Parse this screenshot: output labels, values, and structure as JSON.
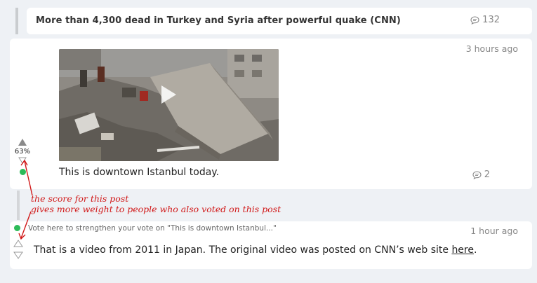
{
  "thread": {
    "title": "More than 4,300 dead in Turkey and Syria after powerful quake (CNN)",
    "comment_count": "132"
  },
  "post": {
    "time": "3 hours ago",
    "text": "This is downtown Istanbul today.",
    "comment_count": "2",
    "vote": {
      "score_label": "63%"
    }
  },
  "annotation": {
    "line1": "the score for this post",
    "line2": "gives more weight to people who also voted on this post"
  },
  "reply": {
    "hint": "Vote here to strengthen your vote on \"This is downtown Istanbul...\"",
    "time": "1 hour ago",
    "text_before": "That is a video from 2011 in Japan. The original video was posted on CNN’s web site ",
    "link_text": "here",
    "text_after": "."
  },
  "colors": {
    "online_dot": "#2dbb59",
    "annotation": "#d11818"
  },
  "icons": [
    "comment-bubble-icon",
    "play-icon",
    "upvote-arrow-icon",
    "downvote-arrow-icon"
  ]
}
